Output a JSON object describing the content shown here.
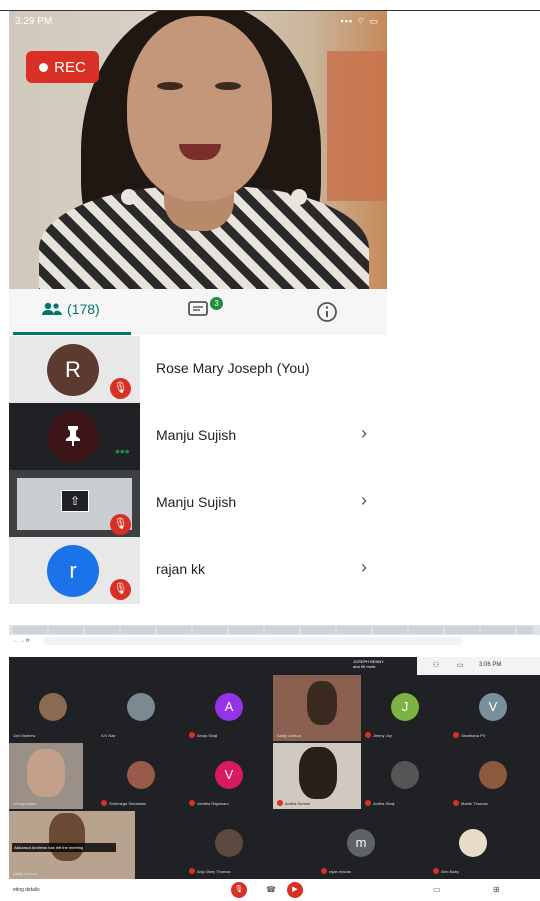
{
  "phone": {
    "status_time": "3:29 PM",
    "rec_label": "REC",
    "tabs": {
      "people_count": "(178)",
      "chat_badge": "3"
    },
    "participants": [
      {
        "initial": "R",
        "name": "Rose Mary Joseph (You)",
        "avatar_color": "#5d3a2f",
        "muted": true
      },
      {
        "initial": "",
        "name": "Manju Sujish",
        "muted": false,
        "more": "•••"
      },
      {
        "initial": "",
        "name": "Manju Sujish",
        "muted": true,
        "presenting": true
      },
      {
        "initial": "r",
        "name": "rajan kk",
        "avatar_color": "#1a73e8",
        "muted": true
      }
    ],
    "colors": {
      "accent": "#00796b",
      "mute_red": "#d93025"
    }
  },
  "browser": {
    "presenter_label": "JOSEPH BENNY",
    "presenter_sub": "and 99 more",
    "time": "3:06 PM",
    "tiles": [
      {
        "name": "Gini Mathew"
      },
      {
        "name": "A K Nair"
      },
      {
        "name": "Anuja Shaji",
        "initial": "A",
        "color": "#9334e6"
      },
      {
        "name": "Aalaji Joshua"
      },
      {
        "name": "Jimmy Joy",
        "initial": "J",
        "color": "#7cb342"
      },
      {
        "name": "Vandhana PV",
        "initial": "V",
        "color": "#78909c"
      },
      {
        "name": "Venugopalan"
      },
      {
        "name": "Srutimega Sebastian"
      },
      {
        "name": "Vanitha Rajarnam",
        "initial": "V",
        "color": "#d81b60"
      },
      {
        "name": "Anitha Suresh"
      },
      {
        "name": "Anitha Shaji"
      },
      {
        "name": "Martin Thomas"
      },
      {
        "name": "Aalaji Joshua"
      },
      {
        "name": "Anju Mary Thomas"
      },
      {
        "name": "rajan mavan",
        "initial": "m",
        "color": "#5f6368"
      },
      {
        "name": "Alex Baby"
      }
    ],
    "notice": "Aikkaraot Andrews has left the meeting",
    "meeting_details": "eting details"
  }
}
